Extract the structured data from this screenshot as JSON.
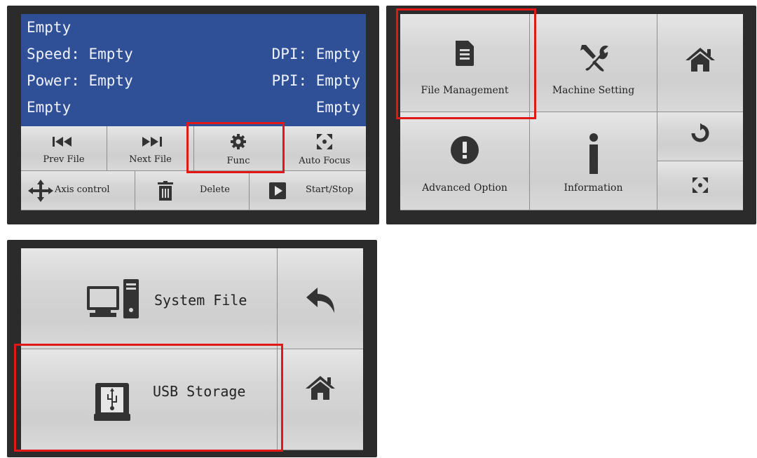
{
  "screen1": {
    "lcd": {
      "line1": "Empty",
      "speed_label": "Speed: Empty",
      "dpi_label": "DPI: Empty",
      "power_label": "Power: Empty",
      "ppi_label": "PPI: Empty",
      "line4_left": "Empty",
      "line4_right": "Empty"
    },
    "buttons": {
      "prev_file": "Prev File",
      "next_file": "Next File",
      "func": "Func",
      "auto_focus": "Auto Focus",
      "axis_control": "Axis control",
      "delete": "Delete",
      "start_stop": "Start/Stop"
    }
  },
  "screen2": {
    "buttons": {
      "file_management": "File Management",
      "machine_setting": "Machine Setting",
      "advanced_option": "Advanced Option",
      "information": "Information"
    },
    "icons": [
      "document-icon",
      "wrench-screwdriver-icon",
      "home-icon",
      "exclamation-icon",
      "info-icon",
      "rotate-icon",
      "focus-icon"
    ]
  },
  "screen3": {
    "buttons": {
      "system_file": "System File",
      "usb_storage": "USB Storage"
    },
    "icons": [
      "computer-icon",
      "usb-drive-icon",
      "back-arrow-icon",
      "home-icon"
    ]
  },
  "colors": {
    "lcd_background": "#2f4f96",
    "highlight_red": "#e01818",
    "button_gray": "#d6d6d6",
    "frame": "#2b2b2b"
  }
}
